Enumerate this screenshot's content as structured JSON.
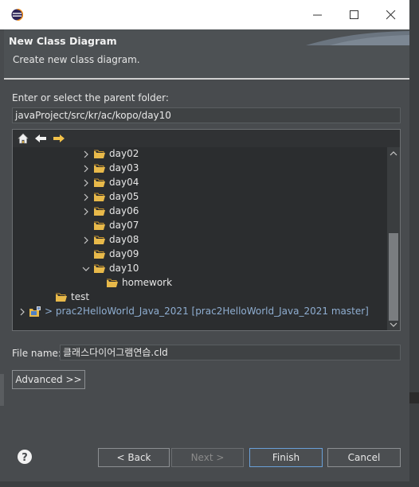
{
  "dialog": {
    "title": "New Class Diagram",
    "description": "Create new class diagram."
  },
  "parent_folder": {
    "label": "Enter or select the parent folder:",
    "value": "javaProject/src/kr/ac/kopo/day10"
  },
  "tree": {
    "items": [
      {
        "label": "day02",
        "expandable": true
      },
      {
        "label": "day03",
        "expandable": true
      },
      {
        "label": "day04",
        "expandable": true
      },
      {
        "label": "day05",
        "expandable": true
      },
      {
        "label": "day06",
        "expandable": true
      },
      {
        "label": "day07",
        "expandable": false
      },
      {
        "label": "day08",
        "expandable": true
      },
      {
        "label": "day09",
        "expandable": false
      },
      {
        "label": "day10",
        "expandable": true,
        "expanded": true
      },
      {
        "label": "homework",
        "expandable": false
      },
      {
        "label": "test",
        "expandable": false
      },
      {
        "label": "> prac2HelloWorld_Java_2021  [prac2HelloWorld_Java_2021 master]",
        "expandable": true
      }
    ]
  },
  "file_name": {
    "label": "File name:",
    "value": "클래스다이어그램연습.cld"
  },
  "buttons": {
    "advanced": "Advanced >>",
    "back": "< Back",
    "next": "Next >",
    "finish": "Finish",
    "cancel": "Cancel"
  },
  "colors": {
    "background": "#484b4e",
    "tree_background": "#2b2d2f",
    "folder": "#e8b94a",
    "project_text": "#8faed1",
    "focus": "#6aa0d8"
  },
  "icons": [
    "home-icon",
    "back-arrow-icon",
    "forward-arrow-icon",
    "folder-icon",
    "chevron-right-icon",
    "chevron-down-icon",
    "project-icon",
    "help-icon"
  ]
}
